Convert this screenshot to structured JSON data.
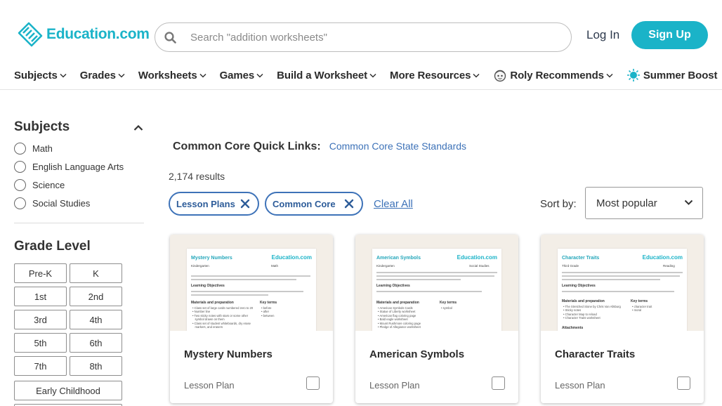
{
  "header": {
    "logo_text": "Education.com",
    "search_placeholder": "Search \"addition worksheets\"",
    "login_label": "Log In",
    "signup_label": "Sign Up"
  },
  "nav": {
    "items": [
      {
        "label": "Subjects"
      },
      {
        "label": "Grades"
      },
      {
        "label": "Worksheets"
      },
      {
        "label": "Games"
      },
      {
        "label": "Build a Worksheet"
      },
      {
        "label": "More Resources"
      },
      {
        "label": "Roly Recommends",
        "icon": "roly-icon"
      },
      {
        "label": "Summer Boost",
        "icon": "sun-icon"
      }
    ]
  },
  "sidebar": {
    "subjects_title": "Subjects",
    "subjects": [
      "Math",
      "English Language Arts",
      "Science",
      "Social Studies"
    ],
    "grade_title": "Grade Level",
    "grades": [
      "Pre-K",
      "K",
      "1st",
      "2nd",
      "3rd",
      "4th",
      "5th",
      "6th",
      "7th",
      "8th"
    ],
    "early_childhood": "Early Childhood"
  },
  "main": {
    "quick_links_label": "Common Core Quick Links:",
    "quick_link": "Common Core State Standards",
    "results": "2,174 results",
    "filters": [
      "Lesson Plans",
      "Common Core"
    ],
    "clear_all": "Clear All",
    "sort_label": "Sort by:",
    "sort_value": "Most popular"
  },
  "cards": [
    {
      "title": "Mystery Numbers",
      "type": "Lesson Plan",
      "sheet_title": "Mystery Numbers",
      "sheet_brand": "Education.com",
      "sheet_grade": "Kindergarten",
      "sheet_subject": "Math",
      "sheet_objectives": "Learning Objectives",
      "sheet_materials": "Materials and preparation",
      "sheet_keyterms": "Key terms",
      "sheet_materials_list": "• Class set of large cards numbered zero to 20\n• Number line\n• Two sticky notes with stars or some other\n   symbol drawn on them\n• Class set of student whiteboards, dry erase\n   markers, and erasers",
      "sheet_keyterms_list": "• before\n• after\n• between"
    },
    {
      "title": "American Symbols",
      "type": "Lesson Plan",
      "sheet_title": "American Symbols",
      "sheet_brand": "Education.com",
      "sheet_grade": "Kindergarten",
      "sheet_subject": "Social Studies",
      "sheet_objectives": "Learning Objectives",
      "sheet_materials": "Materials and preparation",
      "sheet_keyterms": "Key terms",
      "sheet_materials_list": "• American Symbols Cards\n• Statue of Liberty worksheet\n• American flag coloring page\n• Bald eagle worksheet\n• Mount Rushmore coloring page\n• Pledge of Allegiance worksheet",
      "sheet_keyterms_list": "• symbol"
    },
    {
      "title": "Character Traits",
      "type": "Lesson Plan",
      "sheet_title": "Character Traits",
      "sheet_brand": "Education.com",
      "sheet_grade": "Third Grade",
      "sheet_subject": "Reading",
      "sheet_objectives": "Learning Objectives",
      "sheet_materials": "Materials and preparation",
      "sheet_keyterms": "Key terms",
      "sheet_materials_list": "• The Stretched Stone by Chris Van Allsburg\n• Sticky notes\n• Character Map to reload\n• Character Traits worksheet",
      "sheet_keyterms_list": "• character trait\n• moral",
      "sheet_attachments": "Attachments"
    }
  ],
  "colors": {
    "brand": "#1ab3c8",
    "link": "#3d72b8"
  }
}
